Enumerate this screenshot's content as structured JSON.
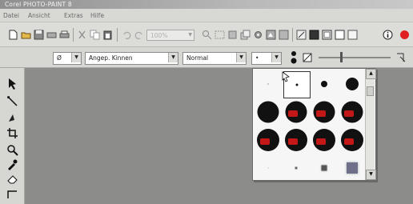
{
  "window": {
    "title": "Corel PHOTO-PAINT 8"
  },
  "menu": {
    "items": [
      "Datei",
      "Ansicht",
      "Extras",
      "Hilfe"
    ]
  },
  "toolbar": {
    "zoom_value": "100%"
  },
  "property_bar": {
    "tool_label": "Ø",
    "brush_type": "Angep. Kinnen",
    "paint_mode": "Normal",
    "nib_preview": "•"
  },
  "brush_popup": {
    "rows": [
      [
        "tiny-dot",
        "small-dot",
        "medium-dot",
        "large-dot"
      ],
      [
        "xl-dot",
        "xl-dot",
        "xl-dot",
        "xl-dot"
      ],
      [
        "xl-dot",
        "xl-dot",
        "xl-dot",
        "xl-dot"
      ],
      [
        "tiny-square",
        "small-square",
        "medium-square",
        "soft-square"
      ]
    ],
    "selected_index": 1
  },
  "colors": {
    "workspace": "#8c8c8a",
    "toolbar": "#dcdcd8",
    "accent_red": "#c41818"
  }
}
